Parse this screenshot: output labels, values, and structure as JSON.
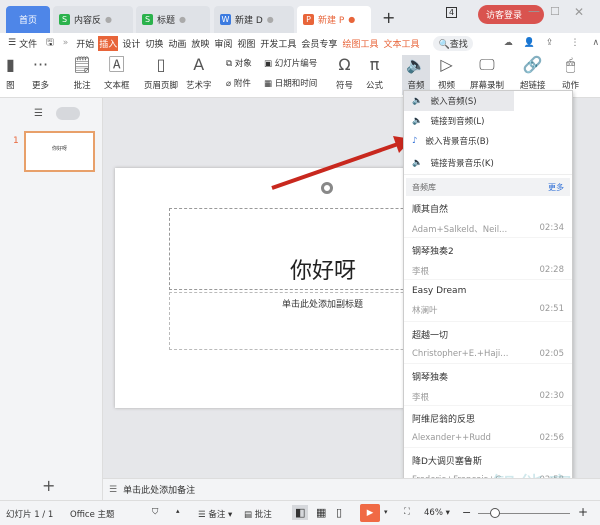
{
  "tabs": [
    {
      "label": "首页"
    },
    {
      "label": "内容反",
      "badge": "S"
    },
    {
      "label": "标题",
      "badge": "S"
    },
    {
      "label": "新建 D",
      "badge": "W"
    },
    {
      "label": "新建 P",
      "badge": "P"
    }
  ],
  "tab_add": "+",
  "window": {
    "badge": "4",
    "login": "访客登录"
  },
  "menu": {
    "file": "文件",
    "items": [
      "开始",
      "插入",
      "设计",
      "切换",
      "动画",
      "放映",
      "审阅",
      "视图",
      "开发工具",
      "会员专享",
      "绘图工具",
      "文本工具"
    ],
    "search": "查找"
  },
  "ribbon": {
    "items": [
      "图",
      "更多",
      "批注",
      "文本框",
      "页眉页脚",
      "艺术字",
      "符号",
      "公式",
      "音频",
      "视频",
      "屏幕录制",
      "超链接",
      "动作"
    ],
    "small": [
      "对象",
      "附件",
      "幻灯片编号",
      "日期和时间"
    ]
  },
  "slide": {
    "number": "1",
    "thumb_text": "你好呀",
    "title": "你好呀",
    "subtitle": "单击此处添加副标题"
  },
  "dropdown": {
    "options": [
      "嵌入音频(S)",
      "链接到音频(L)",
      "嵌入背景音乐(B)",
      "链接背景音乐(K)"
    ],
    "library": "音频库",
    "more": "更多",
    "songs": [
      {
        "title": "顺其自然",
        "artist": "Adam+Salkeld、Neil...",
        "duration": "02:34"
      },
      {
        "title": "钢琴独奏2",
        "artist": "李根",
        "duration": "02:28"
      },
      {
        "title": "Easy Dream",
        "artist": "林澜叶",
        "duration": "02:51"
      },
      {
        "title": "超越一切",
        "artist": "Christopher+E.+Haji...",
        "duration": "02:05"
      },
      {
        "title": "钢琴独奏",
        "artist": "李根",
        "duration": "02:30"
      },
      {
        "title": "阿维尼翁的反思",
        "artist": "Alexander++Rudd",
        "duration": "02:56"
      },
      {
        "title": "降D大调贝塞鲁斯",
        "artist": "Frederic+Francois+C...",
        "duration": "02:58"
      }
    ]
  },
  "notes": "单击此处添加备注",
  "status": {
    "slide": "幻灯片 1 / 1",
    "theme": "Office 主题",
    "notes": "备注",
    "comment": "批注",
    "zoom": "46%"
  },
  "watermark": {
    "text": "智能家",
    "url": "www.znj.com"
  },
  "colors": {
    "accent": "#e8653a",
    "link": "#2f6fd6",
    "arrow": "#c8281e"
  }
}
